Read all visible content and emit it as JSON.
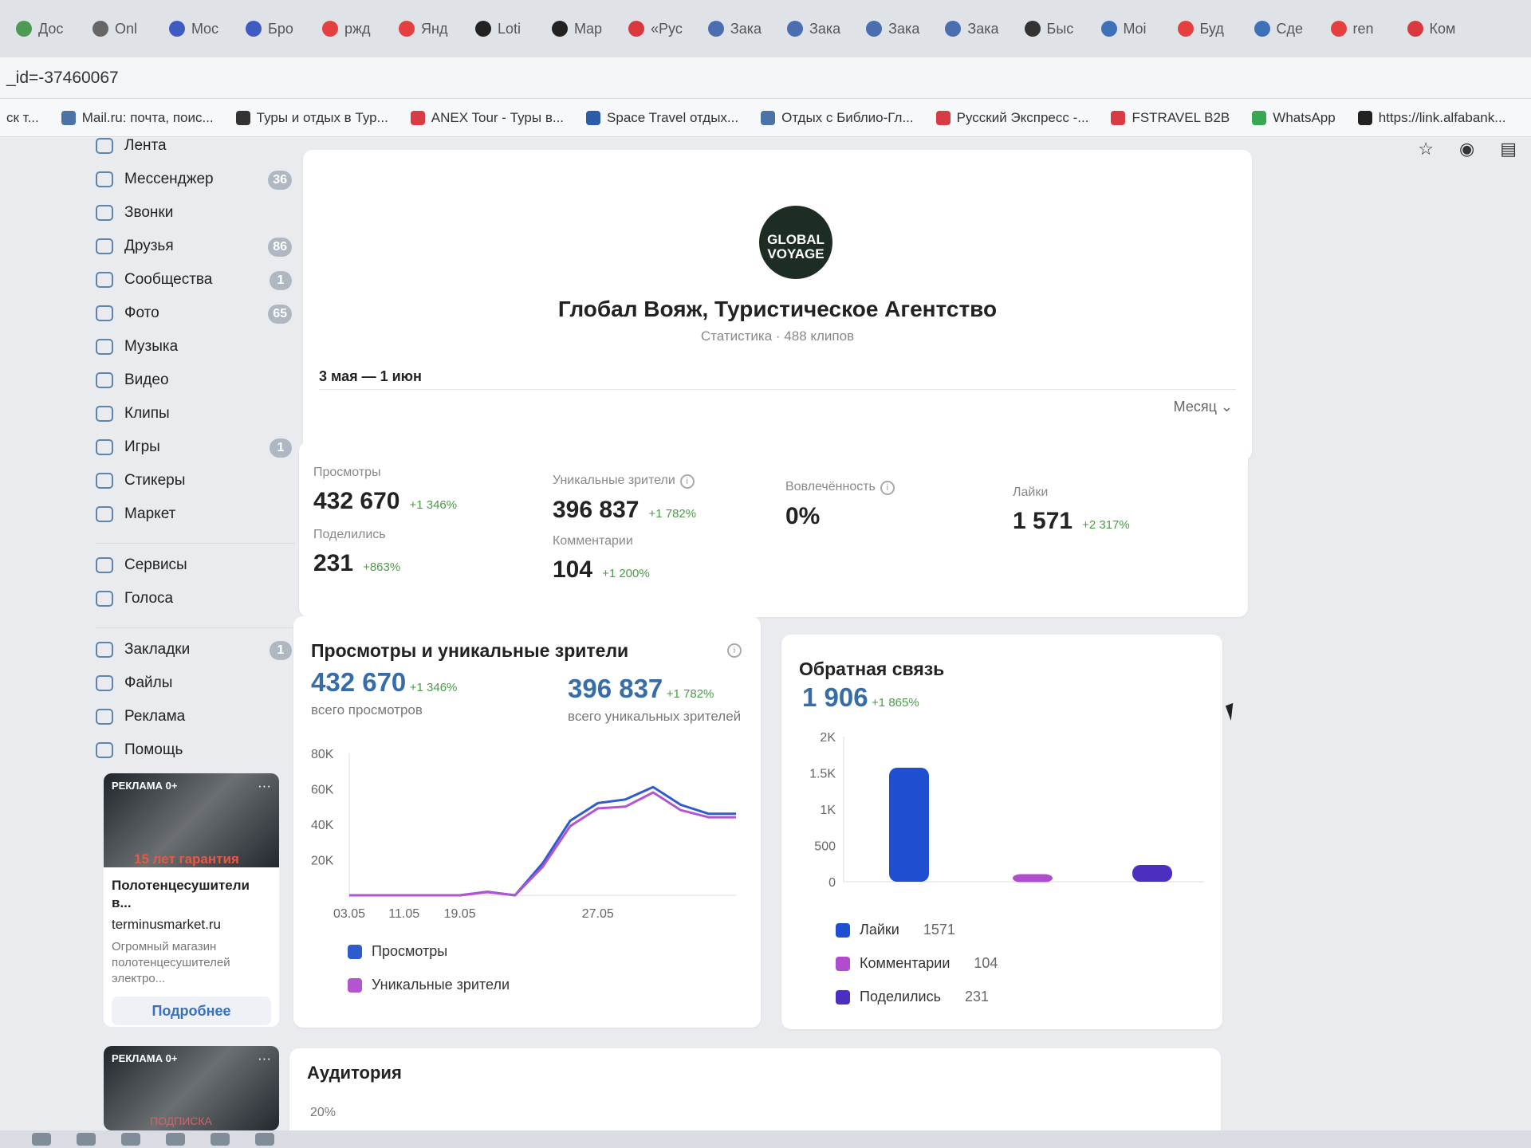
{
  "browser": {
    "tabs": [
      "Доc",
      "Onl",
      "Moc",
      "Бро",
      "ржд",
      "Янд",
      "Loti",
      "Map",
      "«Рус",
      "Зака",
      "Зака",
      "Зака",
      "Зака",
      "Быс",
      "Moi",
      "Буд",
      "Сде",
      "ren",
      "Ком"
    ],
    "address": "_id=-37460067",
    "bookmarks": [
      "ск т...",
      "Mail.ru: почта, поис...",
      "Туры и отдых в Тур...",
      "ANEX Tour - Туры в...",
      "Space Travel отдых...",
      "Отдых с Библио-Гл...",
      "Русский Экспресс -...",
      "FSTRAVEL B2B",
      "WhatsApp",
      "https://link.alfabank..."
    ],
    "toolbar_icons": [
      "star-icon",
      "opera-icon",
      "menu-icon"
    ]
  },
  "sidebar": {
    "items": [
      {
        "label": "Лента",
        "badge": ""
      },
      {
        "label": "Мессенджер",
        "badge": "36"
      },
      {
        "label": "Звонки",
        "badge": ""
      },
      {
        "label": "Друзья",
        "badge": "86"
      },
      {
        "label": "Сообщества",
        "badge": "1"
      },
      {
        "label": "Фото",
        "badge": "65"
      },
      {
        "label": "Музыка",
        "badge": ""
      },
      {
        "label": "Видео",
        "badge": ""
      },
      {
        "label": "Клипы",
        "badge": ""
      },
      {
        "label": "Игры",
        "badge": "1"
      },
      {
        "label": "Стикеры",
        "badge": ""
      },
      {
        "label": "Маркет",
        "badge": ""
      },
      {
        "label": "Сервисы",
        "badge": ""
      },
      {
        "label": "Голоса",
        "badge": ""
      },
      {
        "label": "Закладки",
        "badge": "1"
      },
      {
        "label": "Файлы",
        "badge": ""
      },
      {
        "label": "Реклама",
        "badge": ""
      },
      {
        "label": "Помощь",
        "badge": ""
      }
    ],
    "ads": [
      {
        "label": "РЕКЛАМА 0+",
        "title": "Полотенцесушители в...",
        "domain": "terminusmarket.ru",
        "description": "Огромный магазин полотенцесушителей электро...",
        "button": "Подробнее",
        "image_text": "15 лет гарантия"
      },
      {
        "label": "РЕКЛАМА 0+",
        "image_text": "ПОДПИСКА"
      }
    ]
  },
  "profile": {
    "avatar_text": "GLOBAL VOYAGE",
    "name": "Глобал Вояж, Туристическое Агентство",
    "subtitle": "Статистика · 488 клипов",
    "date_range": "3 мая — 1 июн",
    "period": "Месяц"
  },
  "metrics": {
    "views": {
      "label": "Просмотры",
      "value": "432 670",
      "delta": "+1 346%"
    },
    "unique": {
      "label": "Уникальные зрители",
      "value": "396 837",
      "delta": "+1 782%"
    },
    "engagement": {
      "label": "Вовлечённость",
      "value": "0%"
    },
    "likes": {
      "label": "Лайки",
      "value": "1 571",
      "delta": "+2 317%"
    },
    "shares": {
      "label": "Поделились",
      "value": "231",
      "delta": "+863%"
    },
    "comments": {
      "label": "Комментарии",
      "value": "104",
      "delta": "+1 200%"
    }
  },
  "views_chart": {
    "title": "Просмотры и уникальные зрители",
    "views_total": "432 670",
    "views_delta": "+1 346%",
    "views_label": "всего просмотров",
    "unique_total": "396 837",
    "unique_delta": "+1 782%",
    "unique_label": "всего уникальных зрителей",
    "legend": [
      "Просмотры",
      "Уникальные зрители"
    ]
  },
  "feedback_chart": {
    "title": "Обратная связь",
    "total": "1 906",
    "delta": "+1 865%",
    "legend": [
      {
        "label": "Лайки",
        "value": "1571"
      },
      {
        "label": "Комментарии",
        "value": "104"
      },
      {
        "label": "Поделились",
        "value": "231"
      }
    ]
  },
  "audience": {
    "title": "Аудитория",
    "tick": "20%"
  },
  "chart_data": [
    {
      "type": "line",
      "x": [
        "03.05",
        "07.05",
        "11.05",
        "15.05",
        "19.05",
        "21.05",
        "23.05",
        "25.05",
        "26.05",
        "27.05",
        "28.05",
        "29.05",
        "30.05",
        "31.05",
        "01.06"
      ],
      "series": [
        {
          "name": "Просмотры",
          "values": [
            0,
            0,
            0,
            0,
            0,
            2000,
            0,
            18000,
            42000,
            52000,
            54000,
            61000,
            51000,
            46000,
            46000
          ]
        },
        {
          "name": "Уникальные зрители",
          "values": [
            0,
            0,
            0,
            0,
            0,
            1800,
            0,
            16000,
            39000,
            49000,
            50000,
            58000,
            48000,
            44000,
            44000
          ]
        }
      ],
      "ylim": [
        0,
        80000
      ],
      "yticks": [
        "80K",
        "60K",
        "40K",
        "20K"
      ],
      "xticks": [
        "03.05",
        "11.05",
        "19.05",
        "27.05"
      ],
      "colors": [
        "#2f5ccc",
        "#b255cf"
      ],
      "grid": false,
      "legend": "bottom"
    },
    {
      "type": "bar",
      "categories": [
        "Лайки",
        "Комментарии",
        "Поделились"
      ],
      "values": [
        1571,
        104,
        231
      ],
      "ylim": [
        0,
        2000
      ],
      "yticks": [
        "2K",
        "1.5K",
        "1K",
        "500",
        "0"
      ],
      "colors": [
        "#1f4fd1",
        "#b14ccf",
        "#4d2fc0"
      ],
      "grid": false,
      "legend": "bottom"
    }
  ]
}
